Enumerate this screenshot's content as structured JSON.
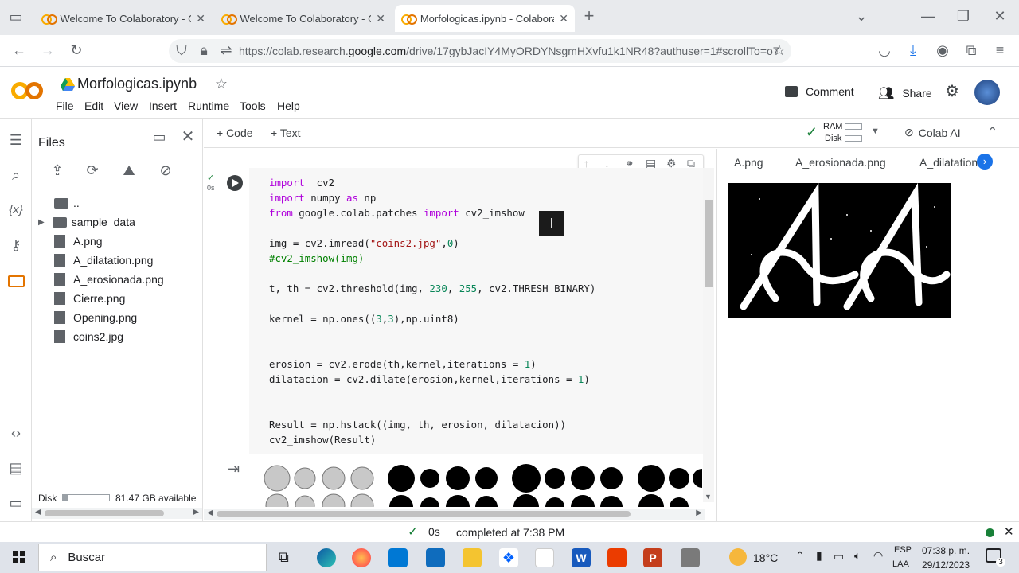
{
  "browser": {
    "tabs": [
      {
        "title": "Welcome To Colaboratory - Colab"
      },
      {
        "title": "Welcome To Colaboratory - Colab"
      },
      {
        "title": "Morfologicas.ipynb - Colaboratory"
      }
    ],
    "new_tab": "+",
    "url_prefix": "https://colab.research.",
    "url_domain": "google.com",
    "url_suffix": "/drive/17gybJacIY4MyORDYNsgmHXvfu1k1NR48?authuser=1#scrollTo=o7"
  },
  "colab": {
    "title": "Morfologicas.ipynb",
    "menu": [
      "File",
      "Edit",
      "View",
      "Insert",
      "Runtime",
      "Tools",
      "Help"
    ],
    "comment": "Comment",
    "share": "Share"
  },
  "files_panel": {
    "title": "Files",
    "items": [
      {
        "name": "..",
        "type": "up"
      },
      {
        "name": "sample_data",
        "type": "folder"
      },
      {
        "name": "A.png",
        "type": "file"
      },
      {
        "name": "A_dilatation.png",
        "type": "file"
      },
      {
        "name": "A_erosionada.png",
        "type": "file"
      },
      {
        "name": "Cierre.png",
        "type": "file"
      },
      {
        "name": "Opening.png",
        "type": "file"
      },
      {
        "name": "coins2.jpg",
        "type": "file"
      }
    ],
    "disk_label": "Disk",
    "disk_available": "81.47 GB available",
    "disk_used_fraction": 0.12
  },
  "nb_toolbar": {
    "code": "+ Code",
    "text": "+ Text",
    "ram": "RAM",
    "disk": "Disk",
    "colab_ai": "Colab AI"
  },
  "cell": {
    "exec_time": "0s",
    "lines": [
      [
        [
          "kw",
          "import"
        ],
        [
          "",
          "  cv2"
        ]
      ],
      [
        [
          "kw",
          "import"
        ],
        [
          "",
          " numpy "
        ],
        [
          "kw",
          "as"
        ],
        [
          "",
          " np"
        ]
      ],
      [
        [
          "kw",
          "from"
        ],
        [
          "",
          " google.colab.patches "
        ],
        [
          "kw",
          "import"
        ],
        [
          "",
          " cv2_imshow"
        ]
      ],
      [],
      [
        [
          "",
          "img = cv2.imread("
        ],
        [
          "st",
          "\"coins2.jpg\""
        ],
        [
          "",
          ","
        ],
        [
          "nm",
          "0"
        ],
        [
          "",
          ")"
        ]
      ],
      [
        [
          "cm",
          "#cv2_imshow(img)"
        ]
      ],
      [],
      [
        [
          "",
          "t, th = cv2.threshold(img, "
        ],
        [
          "nm",
          "230"
        ],
        [
          "",
          ", "
        ],
        [
          "nm",
          "255"
        ],
        [
          "",
          ", cv2.THRESH_BINARY)"
        ]
      ],
      [],
      [
        [
          "",
          "kernel = np.ones(("
        ],
        [
          "nm",
          "3"
        ],
        [
          "",
          ","
        ],
        [
          "nm",
          "3"
        ],
        [
          "",
          "),np.uint8)"
        ]
      ],
      [],
      [],
      [
        [
          "",
          "erosion = cv2.erode(th,kernel,iterations = "
        ],
        [
          "nm",
          "1"
        ],
        [
          "",
          ")"
        ]
      ],
      [
        [
          "",
          "dilatacion = cv2.dilate(erosion,kernel,iterations = "
        ],
        [
          "nm",
          "1"
        ],
        [
          "",
          ")"
        ]
      ],
      [],
      [],
      [
        [
          "",
          "Result = np.hstack((img, th, erosion, dilatacion))"
        ]
      ],
      [
        [
          "",
          "cv2_imshow(Result)"
        ]
      ]
    ]
  },
  "viewer": {
    "tabs": [
      "A.png",
      "A_erosionada.png",
      "A_dilatation"
    ]
  },
  "status": {
    "time": "0s",
    "message": "completed at 7:38 PM"
  },
  "taskbar": {
    "search": "Buscar",
    "weather": "18°C",
    "lang1": "ESP",
    "lang2": "LAA",
    "clock_time": "07:38 p. m.",
    "clock_date": "29/12/2023",
    "notif": "3"
  },
  "colors": {
    "colab_orange": "#f9ab00",
    "keyword": "#af00db",
    "string": "#a31515",
    "number": "#098658",
    "comment": "#008000"
  }
}
